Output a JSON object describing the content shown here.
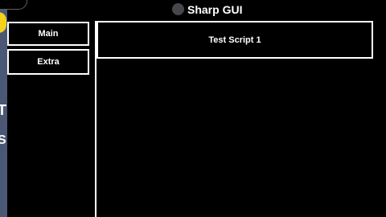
{
  "window": {
    "title": "Sharp GUI",
    "logo_icon": "circle-logo-icon"
  },
  "sidebar": {
    "tabs": [
      {
        "label": "Main"
      },
      {
        "label": "Extra"
      }
    ]
  },
  "main": {
    "scripts": [
      {
        "label": "Test Script 1"
      }
    ]
  },
  "background": {
    "edge_letters": [
      "T",
      "S"
    ]
  },
  "colors": {
    "background": "#000000",
    "text": "#ffffff",
    "border": "#ffffff",
    "logo": "#46474b",
    "edge_strip": "#4b5875",
    "edge_badge": "#f2d21b"
  }
}
